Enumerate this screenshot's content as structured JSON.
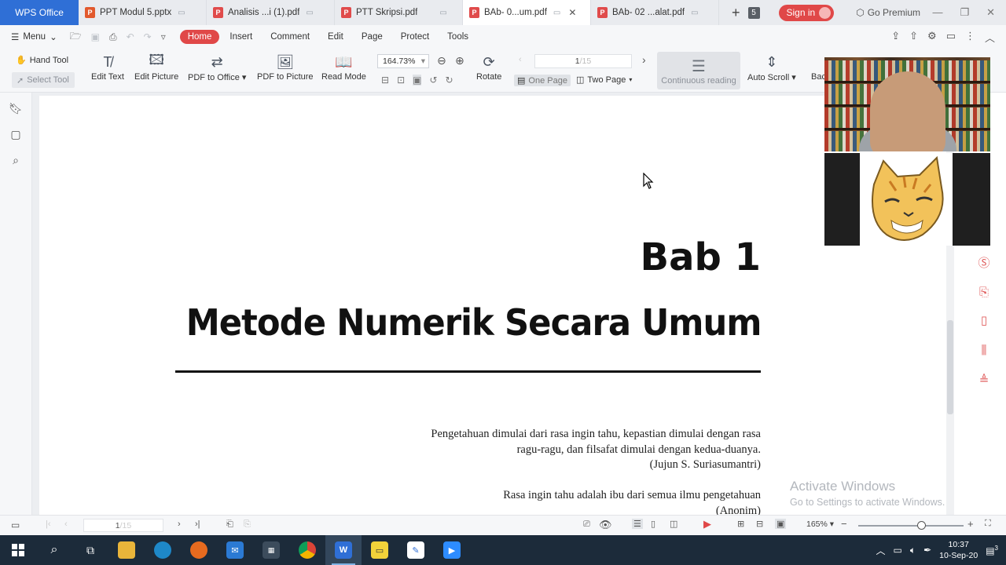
{
  "app": {
    "name": "WPS Office"
  },
  "tabs": [
    {
      "label": "PPT Modul 5.pptx",
      "type": "ppt",
      "active": false
    },
    {
      "label": "Analisis ...i (1).pdf",
      "type": "pdf",
      "active": false
    },
    {
      "label": "PTT Skripsi.pdf",
      "type": "pdf",
      "active": false
    },
    {
      "label": "BAb- 0...um.pdf",
      "type": "pdf",
      "active": true
    },
    {
      "label": "BAb- 02 ...alat.pdf",
      "type": "pdf",
      "active": false
    }
  ],
  "tab_controls": {
    "open_tab_count": "5",
    "sign_in_label": "Sign in",
    "go_premium_label": "Go Premium"
  },
  "menubar": {
    "menu_label": "Menu",
    "tabs": [
      "Home",
      "Insert",
      "Comment",
      "Edit",
      "Page",
      "Protect",
      "Tools"
    ],
    "active_tab": "Home"
  },
  "toolbar": {
    "hand_tool": "Hand Tool",
    "select_tool": "Select Tool",
    "edit_text": "Edit Text",
    "edit_picture": "Edit Picture",
    "pdf_to_office": "PDF to Office",
    "pdf_to_picture": "PDF to Picture",
    "read_mode": "Read Mode",
    "zoom_value": "164.73%",
    "rotate": "Rotate",
    "page_value": "1",
    "page_total": "/15",
    "one_page": "One Page",
    "two_page": "Two Page",
    "continuous_reading": "Continuous reading",
    "auto_scroll": "Auto Scroll",
    "back_partial": "Bac"
  },
  "document": {
    "chapter_number": "Bab 1",
    "chapter_title": "Metode Numerik Secara Umum",
    "quote1_lines": [
      "Pengetahuan dimulai dari rasa ingin tahu, kepastian dimulai dengan rasa",
      "ragu-ragu, dan filsafat dimulai dengan kedua-duanya."
    ],
    "quote1_author": "(Jujun S. Suriasumantri)",
    "quote2_line": "Rasa ingin tahu adalah ibu dari semua ilmu pengetahuan",
    "quote2_author": "(Anonim)"
  },
  "watermark": {
    "line1": "Activate Windows",
    "line2": "Go to Settings to activate Windows."
  },
  "statusbar": {
    "page_value": "1",
    "page_total": "/15",
    "zoom_label": "165%",
    "zoom_fraction": 0.6
  },
  "taskbar": {
    "time": "10:37",
    "date": "10-Sep-20",
    "notification_count": "3",
    "apps": [
      "start",
      "search",
      "task-view",
      "file-explorer",
      "edge",
      "firefox",
      "mail",
      "calendar",
      "chrome",
      "wps-office",
      "notes",
      "pen-app",
      "zoom"
    ]
  },
  "colors": {
    "brand_blue": "#2f6fd6",
    "accent_red": "#e04848",
    "taskbar": "#1c2b3a"
  }
}
